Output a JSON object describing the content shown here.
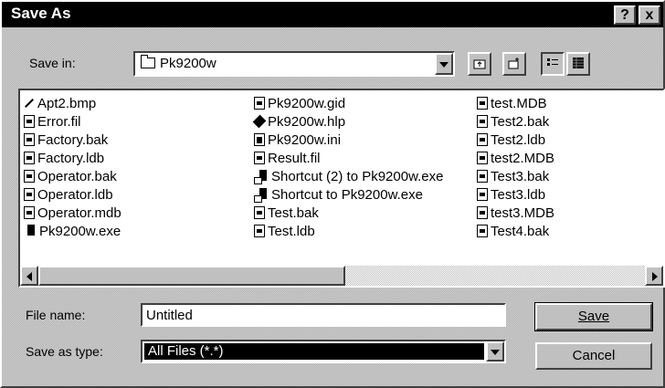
{
  "window": {
    "title": "Save As",
    "help_label": "?",
    "close_label": "x"
  },
  "save_in": {
    "label": "Save in:",
    "folder": "Pk9200w"
  },
  "files": {
    "columns": [
      [
        {
          "name": "Apt2.bmp",
          "icon": "bitmap-icon"
        },
        {
          "name": "Error.fil",
          "icon": "file-icon"
        },
        {
          "name": "Factory.bak",
          "icon": "file-icon"
        },
        {
          "name": "Factory.ldb",
          "icon": "file-icon"
        },
        {
          "name": "Operator.bak",
          "icon": "file-icon"
        },
        {
          "name": "Operator.ldb",
          "icon": "file-icon"
        },
        {
          "name": "Operator.mdb",
          "icon": "file-icon"
        },
        {
          "name": "Pk9200w.exe",
          "icon": "exe-icon"
        }
      ],
      [
        {
          "name": "Pk9200w.gid",
          "icon": "file-icon"
        },
        {
          "name": "Pk9200w.hlp",
          "icon": "help-file-icon"
        },
        {
          "name": "Pk9200w.ini",
          "icon": "ini-file-icon"
        },
        {
          "name": "Result.fil",
          "icon": "file-icon"
        },
        {
          "name": "Shortcut (2) to Pk9200w.exe",
          "icon": "shortcut-icon"
        },
        {
          "name": "Shortcut to Pk9200w.exe",
          "icon": "shortcut-icon"
        },
        {
          "name": "Test.bak",
          "icon": "file-icon"
        },
        {
          "name": "Test.ldb",
          "icon": "file-icon"
        }
      ],
      [
        {
          "name": "test.MDB",
          "icon": "file-icon"
        },
        {
          "name": "Test2.bak",
          "icon": "file-icon"
        },
        {
          "name": "Test2.ldb",
          "icon": "file-icon"
        },
        {
          "name": "test2.MDB",
          "icon": "file-icon"
        },
        {
          "name": "Test3.bak",
          "icon": "file-icon"
        },
        {
          "name": "Test3.ldb",
          "icon": "file-icon"
        },
        {
          "name": "test3.MDB",
          "icon": "file-icon"
        },
        {
          "name": "Test4.bak",
          "icon": "file-icon"
        }
      ]
    ]
  },
  "file_name": {
    "label": "File name:",
    "value": "Untitled"
  },
  "save_as_type": {
    "label": "Save as type:",
    "value": "All Files (*.*)"
  },
  "buttons": {
    "save": "Save",
    "cancel": "Cancel"
  },
  "colors": {
    "titlebar": "#000000",
    "face": "#c0c0c0",
    "selection": "#000000"
  }
}
